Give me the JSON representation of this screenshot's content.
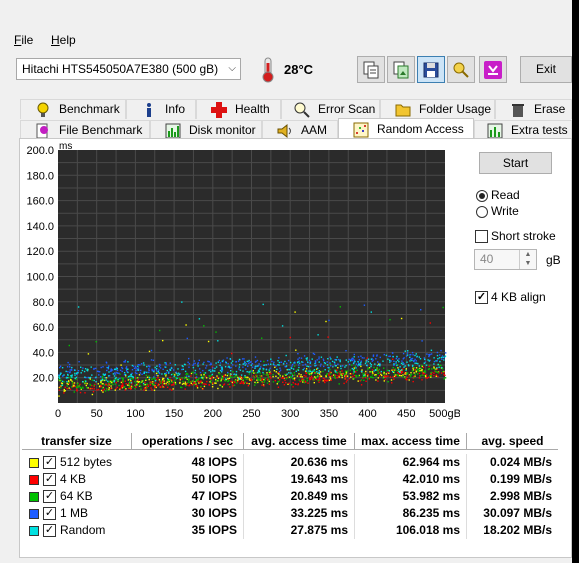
{
  "menu": {
    "file": "File",
    "file_key": "F",
    "file_rest": "ile",
    "help_key": "H",
    "help_rest": "elp"
  },
  "drive": {
    "selected": "Hitachi HTS545050A7E380 (500 gB)"
  },
  "temperature": "28°C",
  "toolbar": {
    "exit_label": "Exit",
    "icons": [
      "copy-text-icon",
      "copy-screenshot-icon",
      "save-icon",
      "search-online-icon",
      "options-download-icon"
    ]
  },
  "tabs_row1": [
    {
      "label": "Benchmark",
      "icon": "lightbulb-icon"
    },
    {
      "label": "Info",
      "icon": "info-icon"
    },
    {
      "label": "Health",
      "icon": "health-cross-icon"
    },
    {
      "label": "Error Scan",
      "icon": "magnifier-icon"
    },
    {
      "label": "Folder Usage",
      "icon": "folder-icon"
    },
    {
      "label": "Erase",
      "icon": "trash-icon"
    }
  ],
  "tabs_row2": [
    {
      "label": "File Benchmark",
      "icon": "file-bulb-icon"
    },
    {
      "label": "Disk monitor",
      "icon": "disk-monitor-icon"
    },
    {
      "label": "AAM",
      "icon": "speaker-icon"
    },
    {
      "label": "Random Access",
      "icon": "random-access-icon",
      "selected": true
    },
    {
      "label": "Extra tests",
      "icon": "extra-tests-icon"
    }
  ],
  "controls": {
    "start_label": "Start",
    "read_label": "Read",
    "write_label": "Write",
    "read_selected": true,
    "short_stroke_label": "Short stroke",
    "short_stroke_checked": false,
    "stroke_value": "40",
    "stroke_unit": "gB",
    "align_label": "4 KB align",
    "align_checked": true
  },
  "chart_data": {
    "type": "scatter",
    "ylabel": "ms",
    "yticks": [
      "200.0",
      "180.0",
      "160.0",
      "140.0",
      "120.0",
      "100.0",
      "80.0",
      "60.0",
      "40.0",
      "20.0"
    ],
    "xticks": [
      "0",
      "50",
      "100",
      "150",
      "200",
      "250",
      "300",
      "350",
      "400",
      "450",
      "500gB"
    ],
    "ylim": [
      0,
      200
    ],
    "xlim": [
      0,
      500
    ],
    "grid": true,
    "background": "#2b2b2b",
    "series": [
      {
        "name": "512 bytes",
        "color": "#ffff00",
        "trend": [
          [
            0,
            14
          ],
          [
            500,
            26
          ]
        ],
        "spread": 9
      },
      {
        "name": "4 KB",
        "color": "#ff0000",
        "trend": [
          [
            0,
            12
          ],
          [
            500,
            24
          ]
        ],
        "spread": 8
      },
      {
        "name": "64 KB",
        "color": "#00c000",
        "trend": [
          [
            0,
            15
          ],
          [
            500,
            27
          ]
        ],
        "spread": 9
      },
      {
        "name": "1 MB",
        "color": "#1e5cff",
        "trend": [
          [
            0,
            25
          ],
          [
            500,
            37
          ]
        ],
        "spread": 9
      },
      {
        "name": "Random",
        "color": "#00e0e0",
        "trend": [
          [
            0,
            22
          ],
          [
            500,
            34
          ]
        ],
        "spread": 11
      }
    ]
  },
  "table": {
    "headers": [
      "transfer size",
      "operations / sec",
      "avg. access time",
      "max. access time",
      "avg. speed"
    ],
    "rows": [
      {
        "name": "512 bytes",
        "color": "#ffff00",
        "checked": true,
        "ops": "48 IOPS",
        "avg": "20.636 ms",
        "max": "62.964 ms",
        "speed": "0.024 MB/s"
      },
      {
        "name": "4 KB",
        "color": "#ff0000",
        "checked": true,
        "ops": "50 IOPS",
        "avg": "19.643 ms",
        "max": "42.010 ms",
        "speed": "0.199 MB/s"
      },
      {
        "name": "64 KB",
        "color": "#00c000",
        "checked": true,
        "ops": "47 IOPS",
        "avg": "20.849 ms",
        "max": "53.982 ms",
        "speed": "2.998 MB/s"
      },
      {
        "name": "1 MB",
        "color": "#1e5cff",
        "checked": true,
        "ops": "30 IOPS",
        "avg": "33.225 ms",
        "max": "86.235 ms",
        "speed": "30.097 MB/s"
      },
      {
        "name": "Random",
        "color": "#00e0e0",
        "checked": true,
        "ops": "35 IOPS",
        "avg": "27.875 ms",
        "max": "106.018 ms",
        "speed": "18.202 MB/s"
      }
    ]
  }
}
